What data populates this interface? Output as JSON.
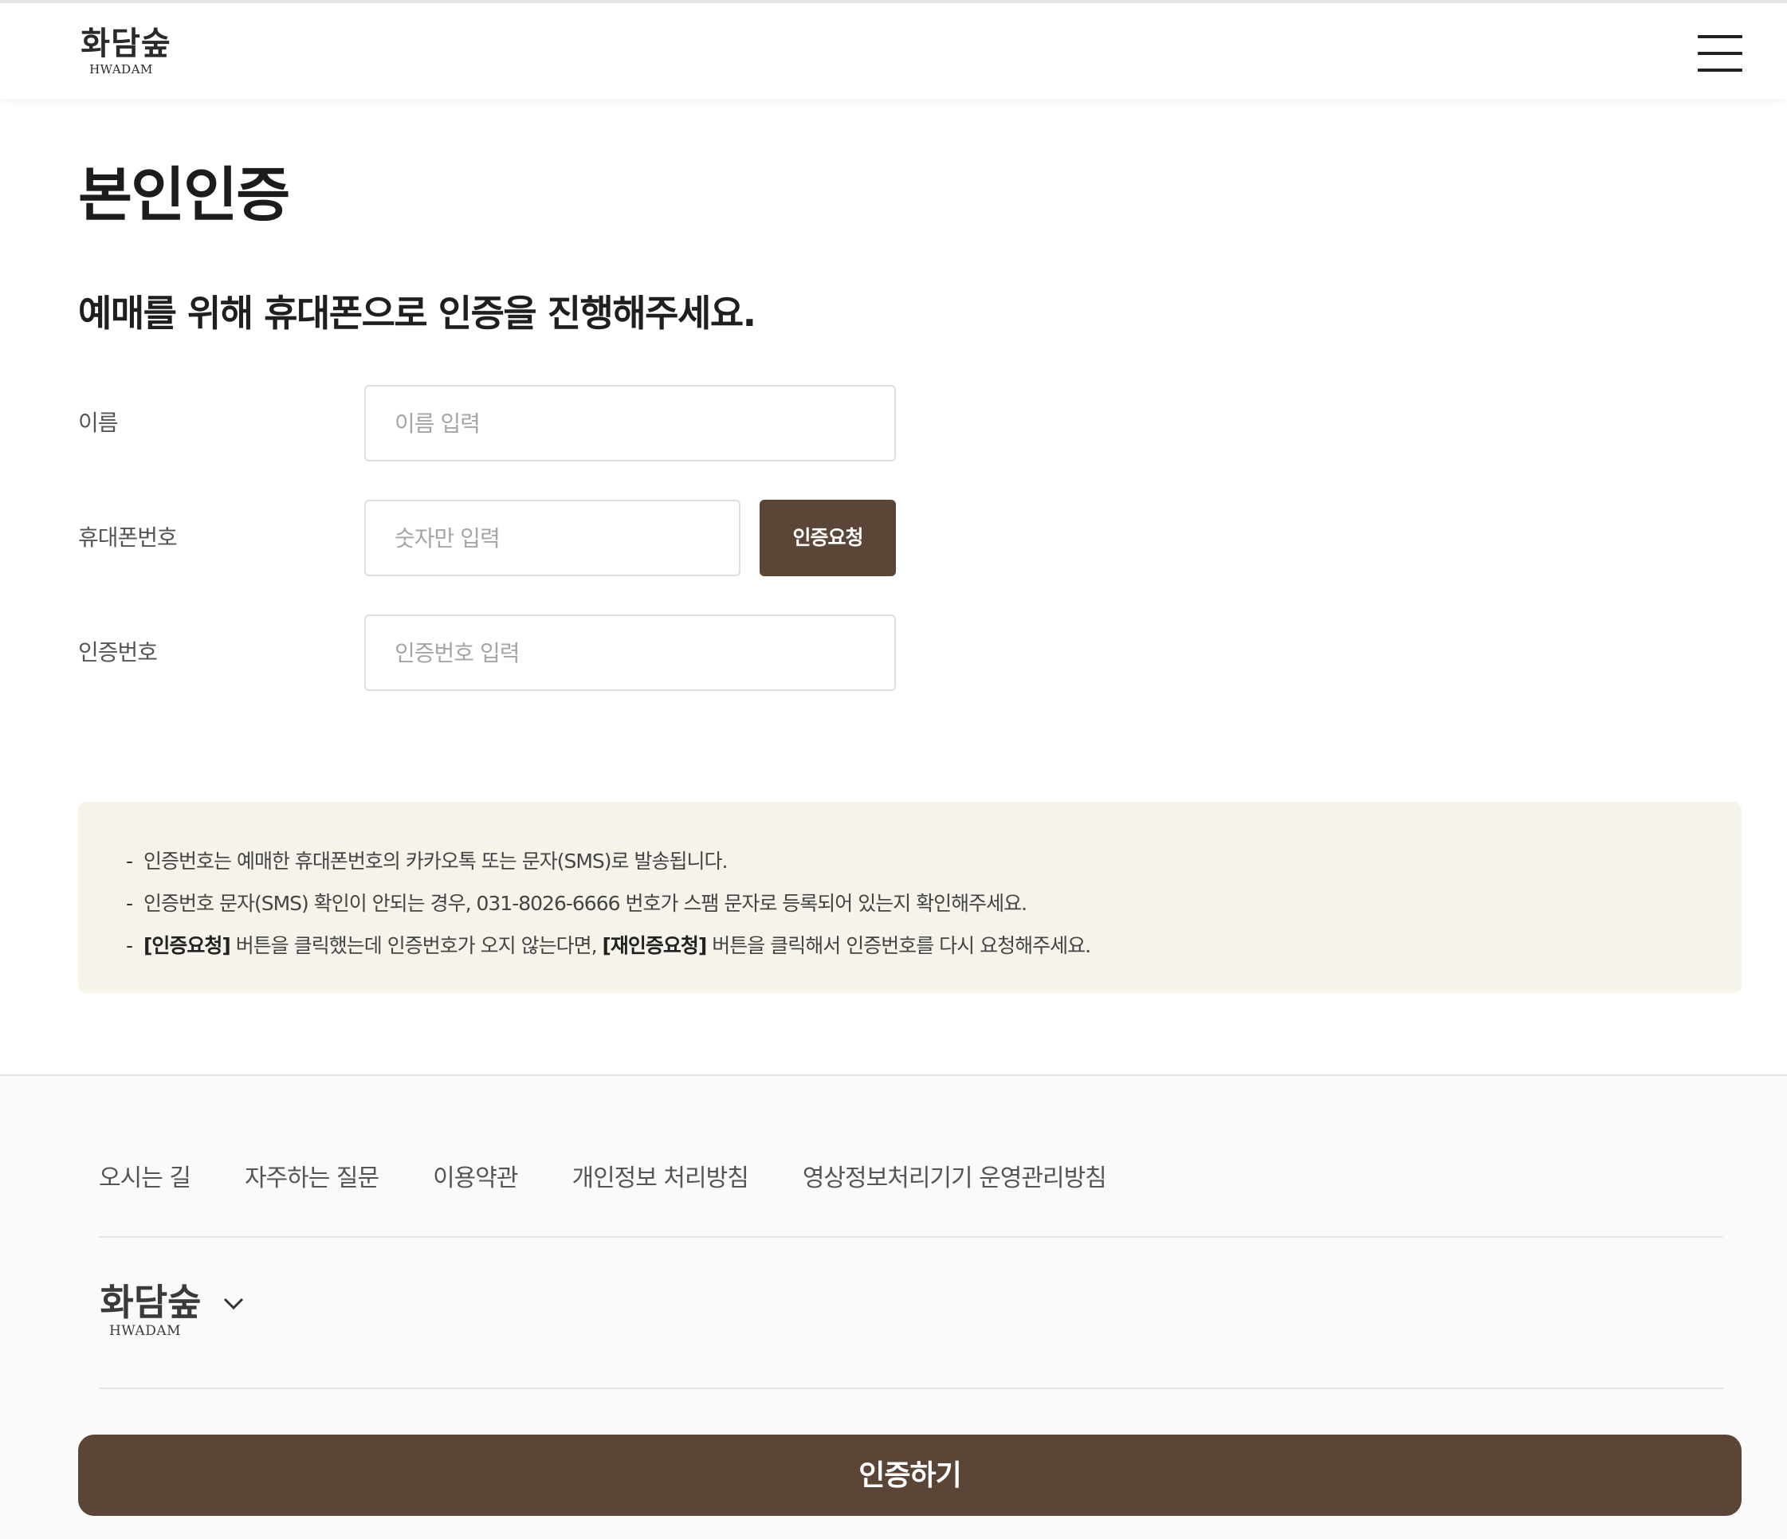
{
  "header": {
    "logo_ko": "화담숲",
    "logo_en": "HWADAM",
    "menu_icon": "hamburger-menu-icon"
  },
  "page": {
    "title": "본인인증",
    "subtitle": "예매를 위해 휴대폰으로 인증을 진행해주세요."
  },
  "form": {
    "name_label": "이름",
    "name_placeholder": "이름 입력",
    "name_value": "",
    "phone_label": "휴대폰번호",
    "phone_placeholder": "숫자만 입력",
    "phone_value": "",
    "request_button": "인증요청",
    "code_label": "인증번호",
    "code_placeholder": "인증번호 입력",
    "code_value": ""
  },
  "notice": {
    "line1": "인증번호는 예매한 휴대폰번호의 카카오톡 또는 문자(SMS)로 발송됩니다.",
    "line2": "인증번호 문자(SMS) 확인이 안되는 경우, 031-8026-6666 번호가 스팸 문자로 등록되어 있는지 확인해주세요.",
    "line3_bold1": "[인증요청]",
    "line3_mid": " 버튼을 클릭했는데 인증번호가 오지 않는다면, ",
    "line3_bold2": "[재인증요청]",
    "line3_end": " 버튼을 클릭해서 인증번호를 다시 요청해주세요."
  },
  "footer": {
    "links": [
      "오시는 길",
      "자주하는 질문",
      "이용약관",
      "개인정보 처리방침",
      "영상정보처리기기 운영관리방침"
    ],
    "logo_ko": "화담숲",
    "logo_en": "HWADAM",
    "family_site_icon": "chevron-down-icon"
  },
  "submit": {
    "label": "인증하기"
  },
  "colors": {
    "brand_brown": "#5a4536",
    "notice_bg": "#f6f3eb"
  }
}
